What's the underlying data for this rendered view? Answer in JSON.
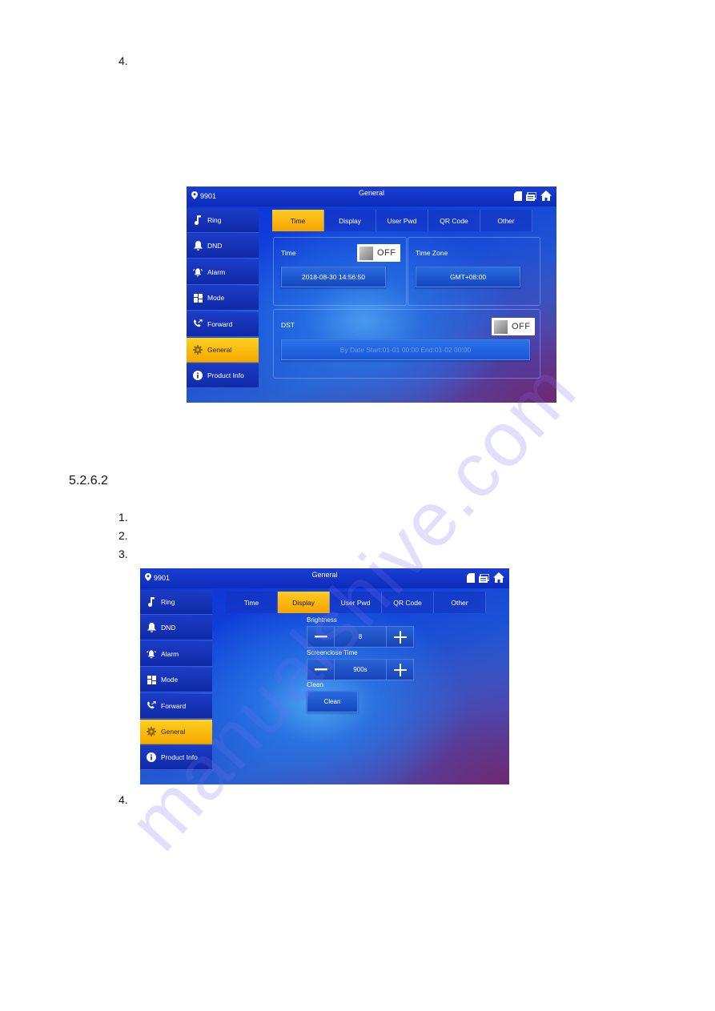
{
  "page": {
    "step_top": "4.",
    "section_heading": "5.2.6.2",
    "steps": [
      "1.",
      "2.",
      "3."
    ],
    "step_bottom": "4.",
    "watermark": "manualshive.com"
  },
  "colors": {
    "accent_active": "#f5b000",
    "topbar": "#0c2bb8",
    "screen_bg": "#1448d8"
  },
  "screens": [
    {
      "header": {
        "location": "9901",
        "title": "General",
        "icons": [
          "sd-card-icon",
          "message-icon",
          "home-icon"
        ]
      },
      "sidebar": [
        {
          "label": "Ring",
          "icon": "music-note-icon"
        },
        {
          "label": "DND",
          "icon": "bell-icon"
        },
        {
          "label": "Alarm",
          "icon": "alarm-bell-icon"
        },
        {
          "label": "Mode",
          "icon": "grid-icon"
        },
        {
          "label": "Forward",
          "icon": "call-forward-icon"
        },
        {
          "label": "General",
          "icon": "gear-icon",
          "active": true
        },
        {
          "label": "Product Info",
          "icon": "info-icon"
        }
      ],
      "tabs": [
        {
          "label": "Time",
          "active": true
        },
        {
          "label": "Display"
        },
        {
          "label": "User Pwd"
        },
        {
          "label": "QR Code"
        },
        {
          "label": "Other"
        }
      ],
      "time_panel": {
        "label": "Time",
        "toggle": "OFF",
        "value": "2018-08-30 14:56:50"
      },
      "timezone_panel": {
        "label": "Time Zone",
        "value": "GMT+08:00"
      },
      "dst_panel": {
        "label": "DST",
        "toggle": "OFF",
        "value": "By Date Start:01-01 00:00  End:01-02 00:00"
      }
    },
    {
      "header": {
        "location": "9901",
        "title": "General",
        "icons": [
          "sd-card-icon",
          "message-icon",
          "home-icon"
        ]
      },
      "sidebar": [
        {
          "label": "Ring",
          "icon": "music-note-icon"
        },
        {
          "label": "DND",
          "icon": "bell-icon"
        },
        {
          "label": "Alarm",
          "icon": "alarm-bell-icon"
        },
        {
          "label": "Mode",
          "icon": "grid-icon"
        },
        {
          "label": "Forward",
          "icon": "call-forward-icon"
        },
        {
          "label": "General",
          "icon": "gear-icon",
          "active": true
        },
        {
          "label": "Product Info",
          "icon": "info-icon"
        }
      ],
      "tabs": [
        {
          "label": "Time"
        },
        {
          "label": "Display",
          "active": true
        },
        {
          "label": "User Pwd"
        },
        {
          "label": "QR Code"
        },
        {
          "label": "Other"
        }
      ],
      "brightness": {
        "label": "Brightness",
        "value": "8",
        "minus": "−",
        "plus": "+"
      },
      "screenclose": {
        "label": "Screenclose Time",
        "value": "900s",
        "minus": "−",
        "plus": "+"
      },
      "clean": {
        "label": "Clean",
        "button": "Clean"
      }
    }
  ]
}
